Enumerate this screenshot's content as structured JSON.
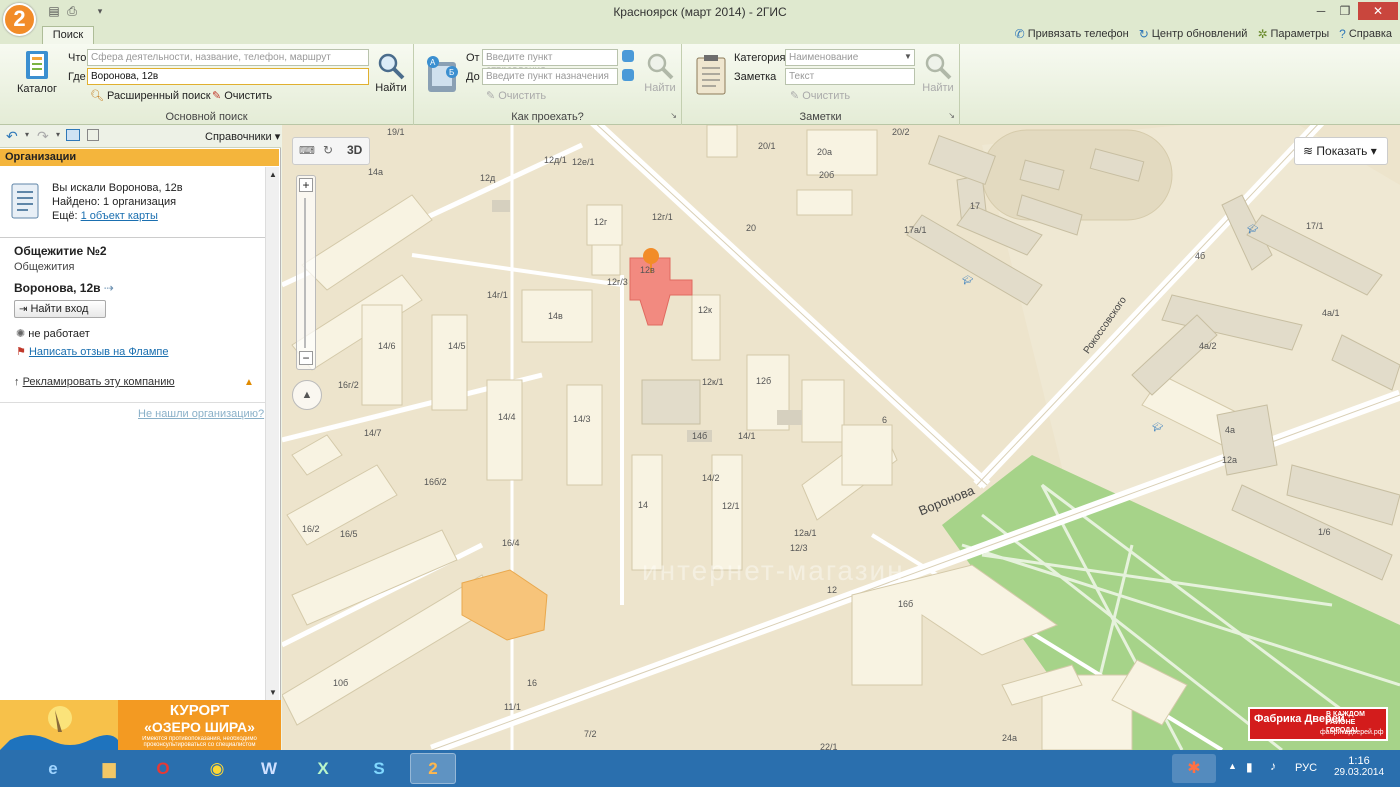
{
  "window": {
    "title": "Красноярск (март 2014) - 2ГИС",
    "logo": "2"
  },
  "tabs": {
    "search": "Поиск"
  },
  "top_links": [
    "Привязать телефон",
    "Центр обновлений",
    "Параметры",
    "Справка"
  ],
  "basic_search": {
    "catalog": "Каталог",
    "what_label": "Что",
    "what_placeholder": "Сфера деятельности, название, телефон, маршрут",
    "where_label": "Где",
    "where_value": "Воронова, 12в",
    "find": "Найти",
    "advanced": "Расширенный поиск",
    "clear": "Очистить",
    "caption": "Основной поиск"
  },
  "route": {
    "from_label": "От",
    "from_placeholder": "Введите пункт отправления",
    "to_label": "До",
    "to_placeholder": "Введите пункт назначения",
    "clear": "Очистить",
    "find": "Найти",
    "caption": "Как проехать?"
  },
  "notes": {
    "category_label": "Категория",
    "category_placeholder": "Наименование",
    "note_label": "Заметка",
    "note_placeholder": "Текст",
    "clear": "Очистить",
    "find": "Найти",
    "caption": "Заметки"
  },
  "left_panel": {
    "directories": "Справочники",
    "section": "Организации",
    "searched": "Вы искали Воронова, 12в",
    "found": "Найдено: 1 организация",
    "more_prefix": "Ещё:",
    "more_link": "1 объект карты",
    "org_name": "Общежитие №2",
    "org_category": "Общежития",
    "org_address": "Воронова, 12в",
    "find_entrance": "Найти вход",
    "status": "не работает",
    "review_link": "Написать отзыв на Флампе",
    "advertise": "Рекламировать эту компанию",
    "not_found": "Не нашли организацию?"
  },
  "map": {
    "show_button": "Показать",
    "mode_3d": "3D",
    "street_voronova": "Воронова",
    "street_rokossovskogo": "Рокоссовского",
    "labels": [
      "19/1",
      "12д/1",
      "12е/1",
      "12д",
      "14а",
      "12г",
      "12г/1",
      "12в",
      "12г/3",
      "14г/1",
      "14в",
      "12к",
      "14/6",
      "14/5",
      "12к/1",
      "12б",
      "16г/2",
      "14/7",
      "14/4",
      "14/3",
      "14б",
      "14/1",
      "16б/2",
      "14/2",
      "14",
      "12/1",
      "12а/1",
      "12/3",
      "12",
      "16б",
      "16/2",
      "16/5",
      "16/4",
      "16",
      "11/1",
      "10б",
      "7/2",
      "24а",
      "22/1",
      "20/1",
      "20/2",
      "20а",
      "20б",
      "20",
      "17",
      "17а/1",
      "17/1",
      "4б",
      "4а/1",
      "4а/2",
      "4а",
      "12а",
      "1/6",
      "6"
    ],
    "watermark": "интернет-магазин",
    "ad_text_1": "В КАЖДОМ РАЙОНЕ ГОРОДА!",
    "ad_brand": "Фабрика Дверей",
    "ad_site": "фабрикадверей.рф"
  },
  "left_ad": {
    "line1": "КУРОРТ",
    "line2": "«ОЗЕРО ШИРА»",
    "line3": "Имеются противопоказания, необходимо проконсультироваться со специалистом"
  },
  "tray": {
    "lang": "РУС",
    "time": "1:16",
    "date": "29.03.2014"
  }
}
